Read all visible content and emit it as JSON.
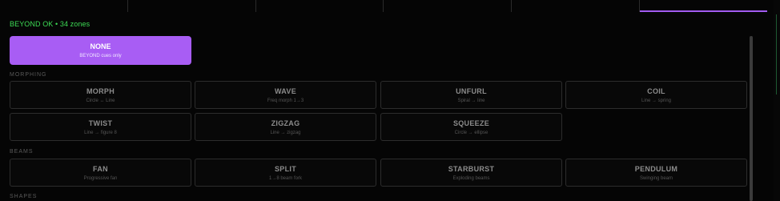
{
  "tabs": [
    {
      "label": ""
    },
    {
      "label": ""
    },
    {
      "label": ""
    },
    {
      "label": ""
    },
    {
      "label": ""
    },
    {
      "label": "",
      "active": true
    }
  ],
  "status": {
    "text": "BEYOND OK • 34 zones"
  },
  "none_button": {
    "title": "NONE",
    "subtitle": "BEYOND cues only"
  },
  "sections": {
    "morphing": "MORPHING",
    "beams": "BEAMS",
    "shapes": "SHAPES"
  },
  "morphing": [
    {
      "title": "MORPH",
      "subtitle": "Circle ↔ Line"
    },
    {
      "title": "WAVE",
      "subtitle": "Freq morph 1→3"
    },
    {
      "title": "UNFURL",
      "subtitle": "Spiral → line"
    },
    {
      "title": "COIL",
      "subtitle": "Line → spring"
    },
    {
      "title": "TWIST",
      "subtitle": "Line → figure 8"
    },
    {
      "title": "ZIGZAG",
      "subtitle": "Line → zigzag"
    },
    {
      "title": "SQUEEZE",
      "subtitle": "Circle → ellipse"
    }
  ],
  "beams": [
    {
      "title": "FAN",
      "subtitle": "Progressive fan"
    },
    {
      "title": "SPLIT",
      "subtitle": "1→8 beam fork"
    },
    {
      "title": "STARBURST",
      "subtitle": "Exploding beams"
    },
    {
      "title": "PENDULUM",
      "subtitle": "Swinging beam"
    }
  ],
  "colors": {
    "accent": "#a85df4",
    "status_ok": "#3ddc55",
    "background": "#050505"
  }
}
